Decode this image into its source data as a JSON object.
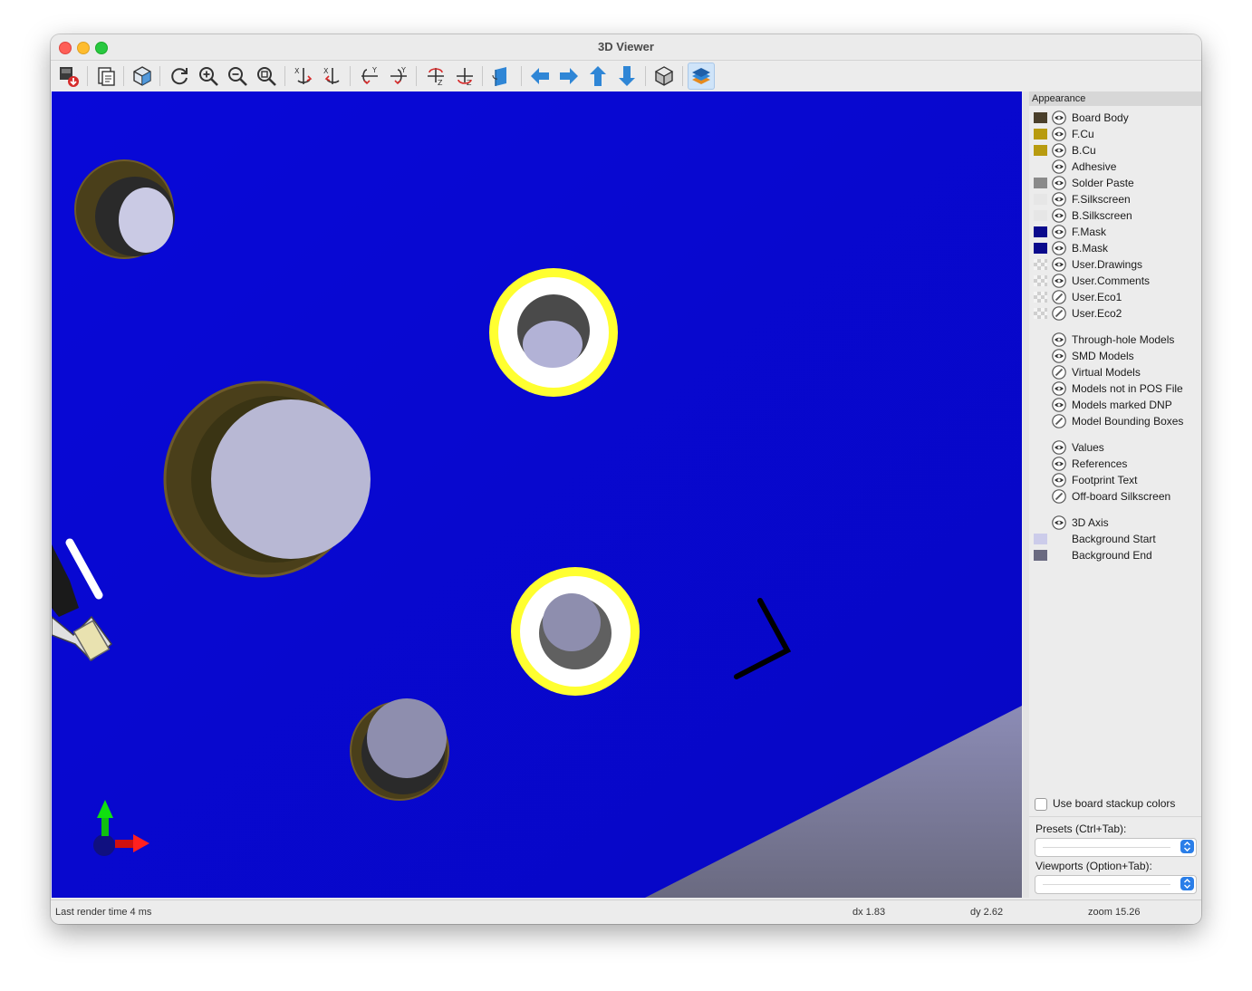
{
  "window": {
    "title": "3D Viewer"
  },
  "toolbar": {
    "buttons": [
      {
        "name": "export-image-icon"
      },
      {
        "name": "copy-clipboard-icon"
      },
      {
        "name": "raytracing-icon"
      },
      {
        "name": "reload-icon"
      },
      {
        "name": "zoom-in-icon"
      },
      {
        "name": "zoom-out-icon"
      },
      {
        "name": "zoom-fit-icon"
      },
      {
        "name": "rotate-x-cw-icon"
      },
      {
        "name": "rotate-x-ccw-icon"
      },
      {
        "name": "rotate-y-cw-icon"
      },
      {
        "name": "rotate-y-ccw-icon"
      },
      {
        "name": "rotate-z-cw-icon"
      },
      {
        "name": "rotate-z-ccw-icon"
      },
      {
        "name": "flip-board-icon"
      },
      {
        "name": "move-left-icon"
      },
      {
        "name": "move-right-icon"
      },
      {
        "name": "move-up-icon"
      },
      {
        "name": "move-down-icon"
      },
      {
        "name": "ortho-view-icon"
      },
      {
        "name": "layers-panel-icon"
      }
    ]
  },
  "appearance": {
    "header": "Appearance",
    "layers": [
      {
        "label": "Board Body",
        "color": "#4a3f2b",
        "visible": true
      },
      {
        "label": "F.Cu",
        "color": "#b89b0f",
        "visible": true
      },
      {
        "label": "B.Cu",
        "color": "#b89b0f",
        "visible": true
      },
      {
        "label": "Adhesive",
        "color": null,
        "visible": true
      },
      {
        "label": "Solder Paste",
        "color": "#8a8a8a",
        "visible": true
      },
      {
        "label": "F.Silkscreen",
        "color": "#e6e6e6",
        "visible": true
      },
      {
        "label": "B.Silkscreen",
        "color": "#e6e6e6",
        "visible": true
      },
      {
        "label": "F.Mask",
        "color": "#0a0a8c",
        "visible": true
      },
      {
        "label": "B.Mask",
        "color": "#0a0a8c",
        "visible": true
      },
      {
        "label": "User.Drawings",
        "color": "checker",
        "visible": true
      },
      {
        "label": "User.Comments",
        "color": "checker",
        "visible": true
      },
      {
        "label": "User.Eco1",
        "color": "checker",
        "visible": false
      },
      {
        "label": "User.Eco2",
        "color": "checker",
        "visible": false
      }
    ],
    "models": [
      {
        "label": "Through-hole Models",
        "visible": true
      },
      {
        "label": "SMD Models",
        "visible": true
      },
      {
        "label": "Virtual Models",
        "visible": false
      },
      {
        "label": "Models not in POS File",
        "visible": true
      },
      {
        "label": "Models marked DNP",
        "visible": true
      },
      {
        "label": "Model Bounding Boxes",
        "visible": false
      }
    ],
    "text": [
      {
        "label": "Values",
        "visible": true
      },
      {
        "label": "References",
        "visible": true
      },
      {
        "label": "Footprint Text",
        "visible": true
      },
      {
        "label": "Off-board Silkscreen",
        "visible": false
      }
    ],
    "misc": [
      {
        "label": "3D Axis",
        "visible": true,
        "color": null
      },
      {
        "label": "Background Start",
        "visible": null,
        "color": "#ccccea"
      },
      {
        "label": "Background End",
        "visible": null,
        "color": "#6a6a80"
      }
    ],
    "stackup_checkbox": "Use board stackup colors",
    "presets_label": "Presets (Ctrl+Tab):",
    "viewports_label": "Viewports (Option+Tab):"
  },
  "status": {
    "render_time": "Last render time 4 ms",
    "dx": "dx 1.83",
    "dy": "dy 2.62",
    "zoom": "zoom 15.26"
  }
}
